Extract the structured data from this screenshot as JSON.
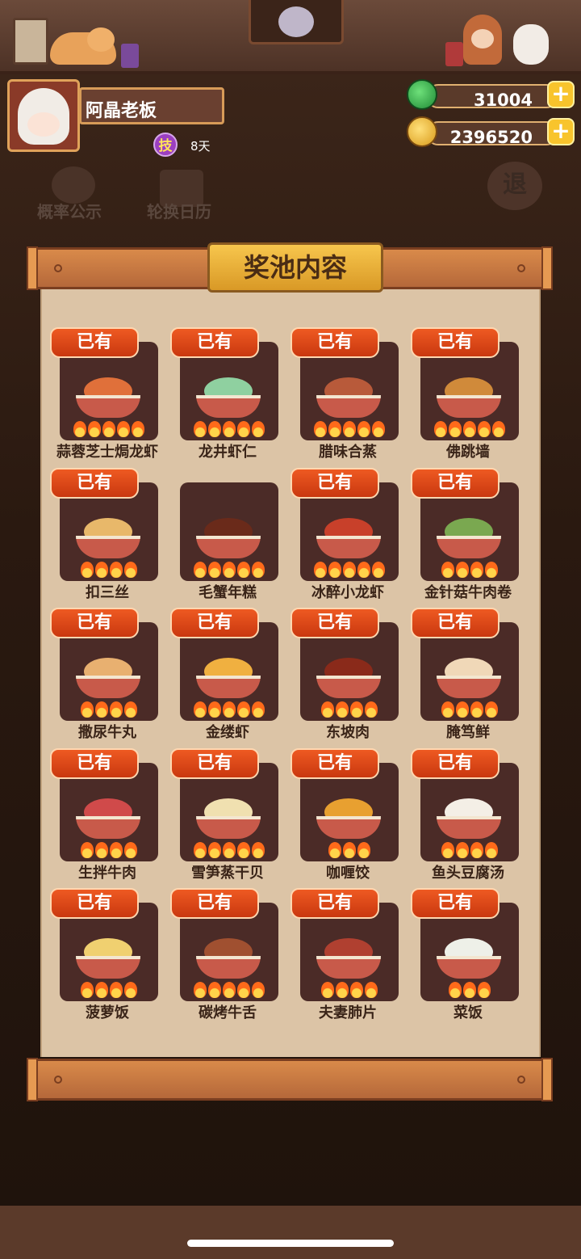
{
  "player": {
    "name": "阿晶老板",
    "skill_icon": "技",
    "days": "8天"
  },
  "currency": [
    {
      "name": "jade",
      "value": "31004",
      "color": "#2fb04a"
    },
    {
      "name": "coin",
      "value": "2396520",
      "color": "#f2c12a"
    }
  ],
  "background_menu": {
    "probability_label": "概率公示",
    "rotation_label": "轮换日历",
    "exit_label": "退"
  },
  "panel": {
    "title": "奖池内容"
  },
  "owned_label": "已有",
  "dishes": [
    {
      "name": "蒜蓉芝士焗龙虾",
      "owned": true,
      "flames": 5,
      "food_color": "#e0703a"
    },
    {
      "name": "龙井虾仁",
      "owned": true,
      "flames": 5,
      "food_color": "#8fd0a0"
    },
    {
      "name": "腊味合蒸",
      "owned": true,
      "flames": 5,
      "food_color": "#b85a3a"
    },
    {
      "name": "佛跳墙",
      "owned": true,
      "flames": 5,
      "food_color": "#d08a3a"
    },
    {
      "name": "扣三丝",
      "owned": true,
      "flames": 4,
      "food_color": "#e8b86a"
    },
    {
      "name": "毛蟹年糕",
      "owned": false,
      "flames": 5,
      "food_color": "#6a2a1a"
    },
    {
      "name": "冰醉小龙虾",
      "owned": true,
      "flames": 5,
      "food_color": "#c8402a"
    },
    {
      "name": "金针菇牛肉卷",
      "owned": true,
      "flames": 4,
      "food_color": "#7aa850"
    },
    {
      "name": "撒尿牛丸",
      "owned": true,
      "flames": 4,
      "food_color": "#e8b070"
    },
    {
      "name": "金缕虾",
      "owned": true,
      "flames": 5,
      "food_color": "#f0b040"
    },
    {
      "name": "东坡肉",
      "owned": true,
      "flames": 4,
      "food_color": "#8a2a1a"
    },
    {
      "name": "腌笃鲜",
      "owned": true,
      "flames": 4,
      "food_color": "#f0d8b8"
    },
    {
      "name": "生拌牛肉",
      "owned": true,
      "flames": 4,
      "food_color": "#d04a4a"
    },
    {
      "name": "雪笋蒸干贝",
      "owned": true,
      "flames": 5,
      "food_color": "#f0e0b0"
    },
    {
      "name": "咖喱饺",
      "owned": true,
      "flames": 3,
      "food_color": "#e8a030"
    },
    {
      "name": "鱼头豆腐汤",
      "owned": true,
      "flames": 4,
      "food_color": "#f4efe6"
    },
    {
      "name": "菠萝饭",
      "owned": true,
      "flames": 4,
      "food_color": "#f0d070"
    },
    {
      "name": "碳烤牛舌",
      "owned": true,
      "flames": 5,
      "food_color": "#a05030"
    },
    {
      "name": "夫妻肺片",
      "owned": true,
      "flames": 4,
      "food_color": "#b04030"
    },
    {
      "name": "菜饭",
      "owned": true,
      "flames": 3,
      "food_color": "#eef0e8"
    }
  ]
}
